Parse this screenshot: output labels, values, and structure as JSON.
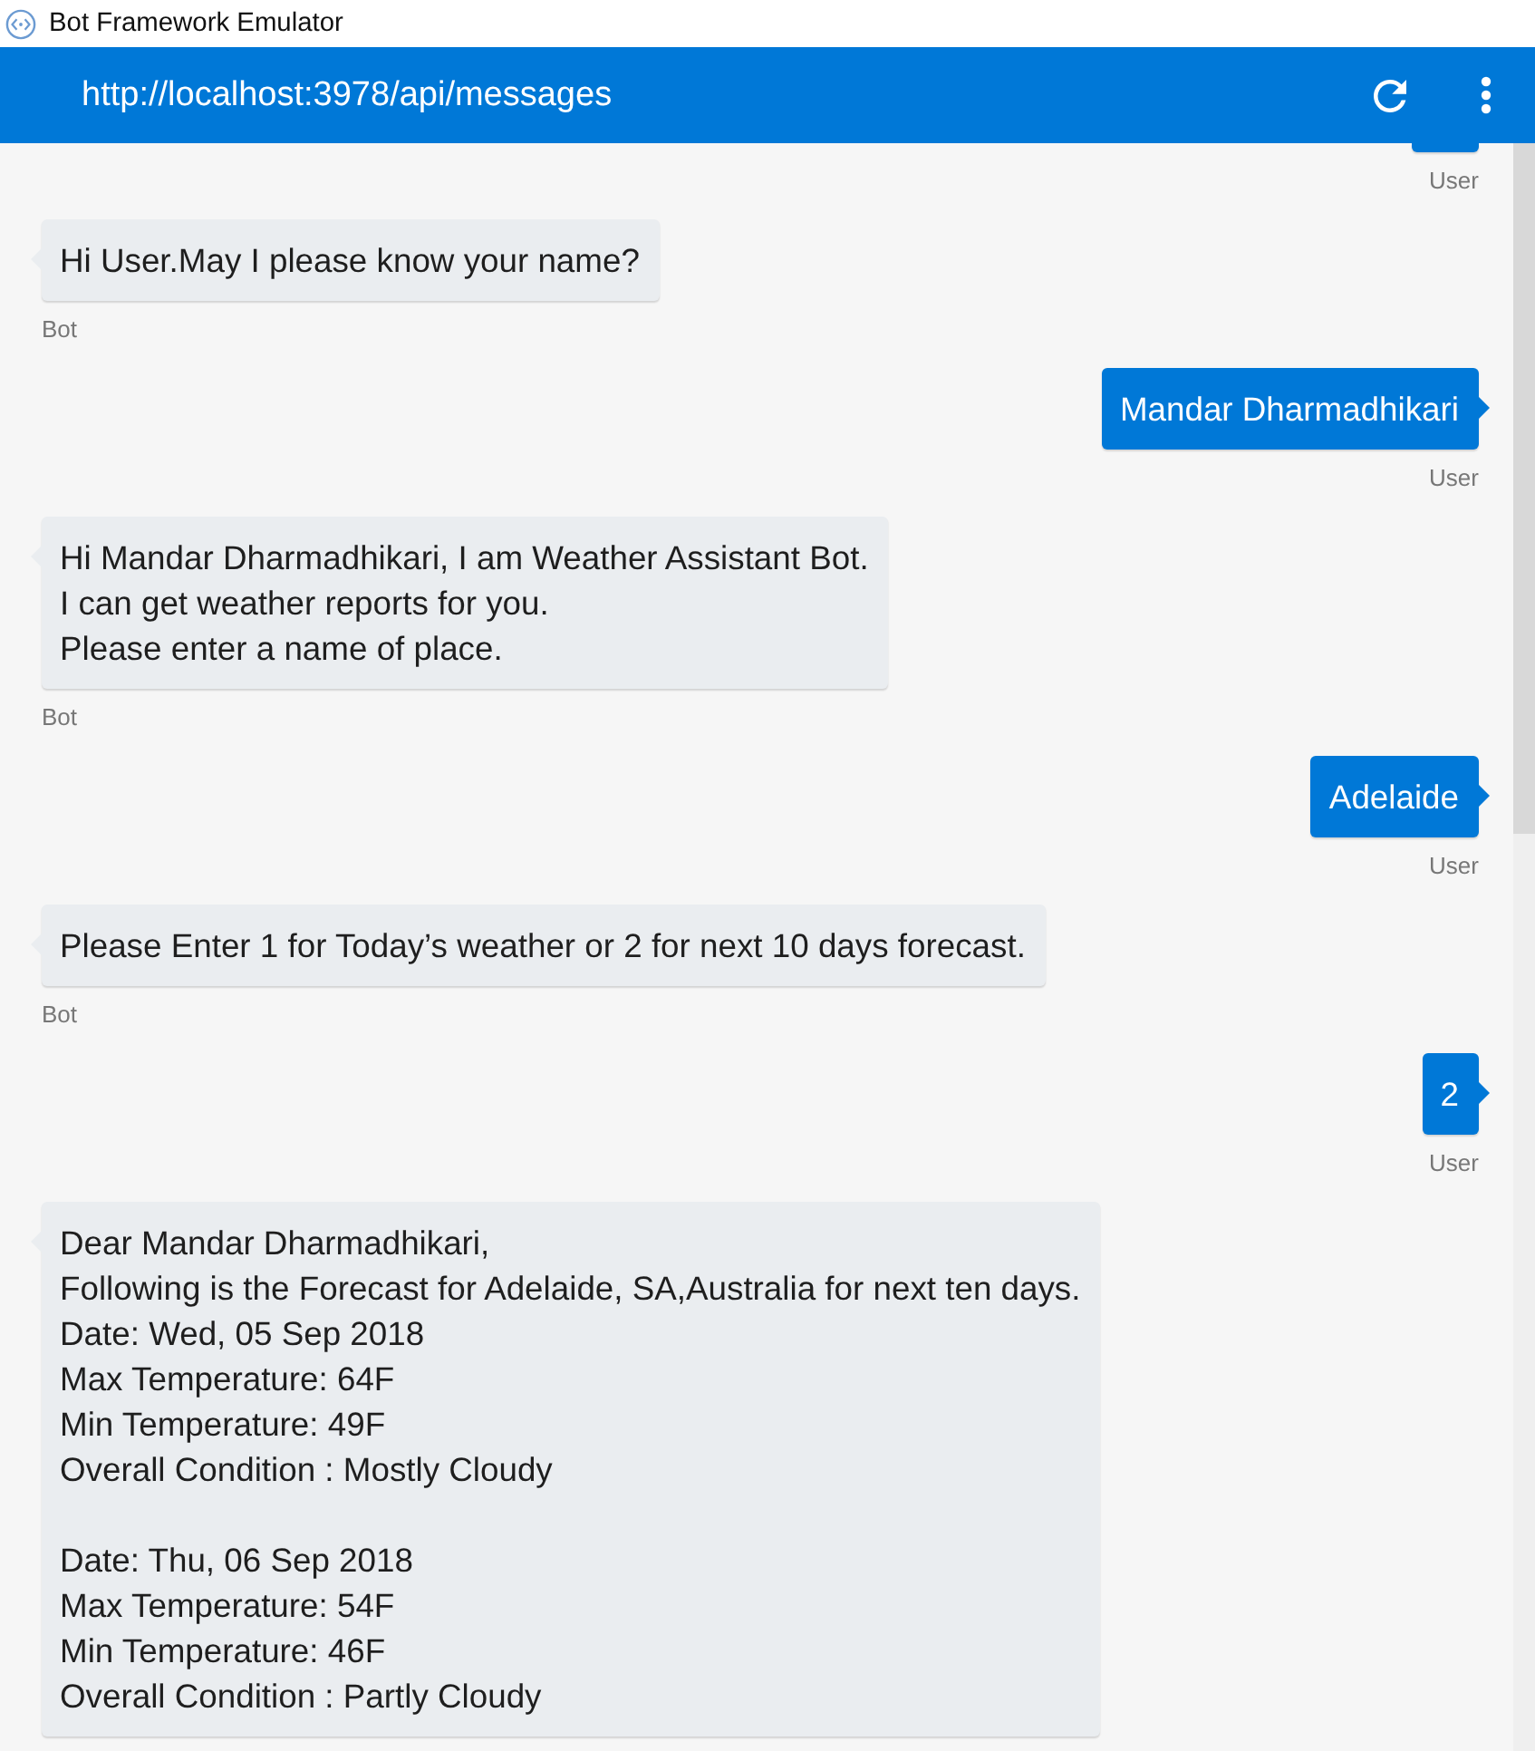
{
  "window": {
    "title": "Bot Framework Emulator"
  },
  "header": {
    "endpoint": "http://localhost:3978/api/messages"
  },
  "messages": [
    {
      "kind": "user",
      "label": "User"
    },
    {
      "kind": "bot",
      "paragraphs": [
        [
          "Hi User.May I please know your name?"
        ]
      ],
      "label": "Bot"
    },
    {
      "kind": "user",
      "paragraphs": [
        [
          "Mandar Dharmadhikari"
        ]
      ],
      "label": "User"
    },
    {
      "kind": "bot",
      "paragraphs": [
        [
          "Hi Mandar Dharmadhikari, I am Weather Assistant Bot.",
          "I can get weather reports for you.",
          "Please enter a name of place."
        ]
      ],
      "label": "Bot"
    },
    {
      "kind": "user",
      "paragraphs": [
        [
          "Adelaide"
        ]
      ],
      "label": "User"
    },
    {
      "kind": "bot",
      "paragraphs": [
        [
          "Please Enter 1 for Today’s weather or 2 for next 10 days forecast."
        ]
      ],
      "label": "Bot"
    },
    {
      "kind": "user",
      "paragraphs": [
        [
          "2"
        ]
      ],
      "label": "User"
    },
    {
      "kind": "bot",
      "paragraphs": [
        [
          "Dear Mandar Dharmadhikari,",
          "Following is the Forecast for Adelaide, SA,Australia for next ten days.",
          "Date: Wed, 05 Sep 2018",
          "Max Temperature: 64F",
          "Min Temperature: 49F",
          "Overall Condition : Mostly Cloudy"
        ],
        [
          "Date: Thu, 06 Sep 2018",
          "Max Temperature: 54F",
          "Min Temperature: 46F",
          "Overall Condition : Partly Cloudy"
        ]
      ]
    }
  ]
}
